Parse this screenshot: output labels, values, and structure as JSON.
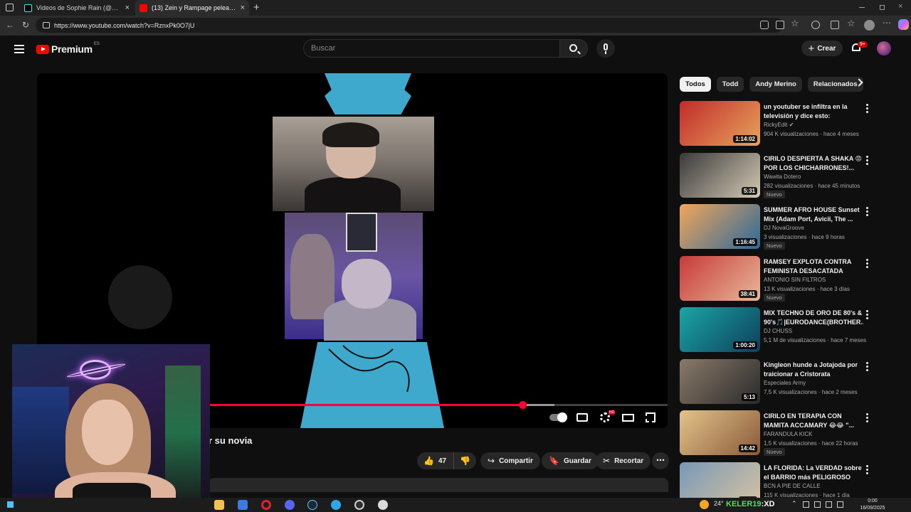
{
  "browser": {
    "tabs": [
      {
        "label": "Videos de Sophie Rain (@sophie...",
        "favicon": "tiktok-icon",
        "active": false
      },
      {
        "label": "(13) Zein y Rampage peleados co...",
        "favicon": "youtube-icon",
        "active": true
      }
    ],
    "new_tab": "+",
    "url": "https://www.youtube.com/watch?v=RznxPk0O7jU"
  },
  "youtube": {
    "logo_text": "Premium",
    "logo_region": "ES",
    "search_placeholder": "Buscar",
    "create_label": "Crear",
    "notif_badge": "9+",
    "colors": {
      "accent": "#ff0033",
      "brand": "#ff0000",
      "bg": "#0f0f0f"
    }
  },
  "player": {
    "progress": 0.77,
    "buffered": 0.82,
    "hd_badge": "HD"
  },
  "video": {
    "title_visible": "r su novia",
    "likes": "47",
    "share": "Compartir",
    "save": "Guardar",
    "clip": "Recortar",
    "more": "⋯"
  },
  "sidebar": {
    "chips": [
      "Todos",
      "Todd",
      "Andy Merino",
      "Relacionados"
    ],
    "items": [
      {
        "title": "un youtuber se infiltra en la televisión y dice esto:",
        "channel": "RickyEdit ✔",
        "meta": "904 K visualizaciones · hace 4 meses",
        "duration": "1:14:02",
        "new": false,
        "thumb": [
          "#c22b2b",
          "#e6a45c"
        ]
      },
      {
        "title": "CIRILO DESPIERTA A SHAKA 😡 POR LOS CHICHARRONES!...",
        "channel": "Wawita Dotero",
        "meta": "282 visualizaciones · hace 45 minutos",
        "duration": "5:31",
        "new": true,
        "new_label": "Nuevo",
        "thumb": [
          "#3a3a3a",
          "#d4c9b4"
        ]
      },
      {
        "title": "SUMMER AFRO HOUSE Sunset Mix (Adam Port, Avicii, The ...",
        "channel": "DJ NovaGroove",
        "meta": "3 visualizaciones · hace 9 horas",
        "duration": "1:16:45",
        "new": true,
        "new_label": "Nuevo",
        "thumb": [
          "#f2a65a",
          "#2d6a9a"
        ]
      },
      {
        "title": "RAMSEY EXPLOTA CONTRA FEMINISTA DESACATADA",
        "channel": "ANTONIO SIN FILTROS",
        "meta": "13 K visualizaciones · hace 3 días",
        "duration": "38:41",
        "new": true,
        "new_label": "Nuevo",
        "thumb": [
          "#c83a3a",
          "#e8b89a"
        ]
      },
      {
        "title": "MIX TECHNO DE ORO DE 80's & 90's🎵|EURODANCE(BROTHER...",
        "channel": "DJ CHUSS",
        "meta": "5,1 M de visualizaciones · hace 7 meses",
        "duration": "1:00:20",
        "new": false,
        "thumb": [
          "#1aa6a6",
          "#0d3f5a"
        ]
      },
      {
        "title": "Kingleon hunde a Jotajoda por traicionar a Cristorata",
        "channel": "Especiales Army",
        "meta": "7,5 K visualizaciones · hace 2 meses",
        "duration": "5:13",
        "new": false,
        "thumb": [
          "#8a7a6a",
          "#2a2a2a"
        ]
      },
      {
        "title": "CIRILO EN TERAPIA CON MAMITA ACCAMARY 😂😂 \"...",
        "channel": "FARANDULA KICK",
        "meta": "1,5 K visualizaciones · hace 22 horas",
        "duration": "14:42",
        "new": true,
        "new_label": "Nuevo",
        "thumb": [
          "#e2c48a",
          "#8a5a3a"
        ]
      },
      {
        "title": "LA FLORIDA: La VERDAD sobre el BARRIO más PELIGROSO de...",
        "channel": "BCN A PIE DE CALLE",
        "meta": "115 K visualizaciones · hace 1 día",
        "duration": "23:27",
        "new": false,
        "thumb": [
          "#7a98b8",
          "#d6c3a2"
        ]
      }
    ]
  },
  "taskbar": {
    "weather": "24°",
    "overlay_name": "KELER19",
    "overlay_suffix": ":XD",
    "time": "0:00",
    "date": "16/09/2025"
  }
}
